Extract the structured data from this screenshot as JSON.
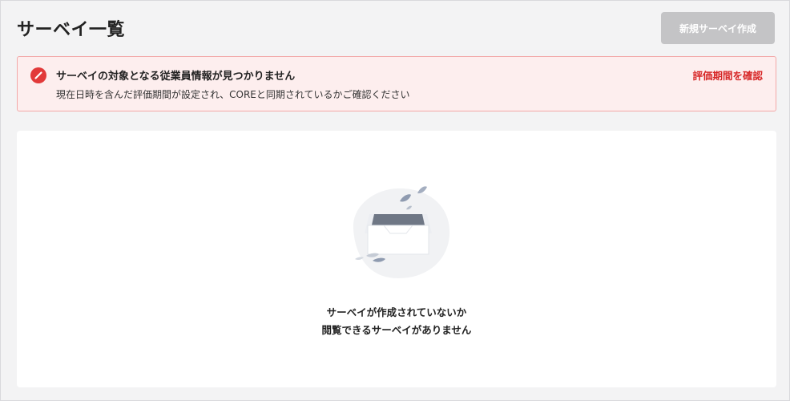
{
  "header": {
    "title": "サーベイ一覧",
    "create_button_label": "新規サーベイ作成"
  },
  "alert": {
    "title": "サーベイの対象となる従業員情報が見つかりません",
    "body": "現在日時を含んだ評価期間が設定され、COREと同期されているかご確認ください",
    "link_label": "評価期間を確認",
    "icon": "prohibited-icon",
    "accent_color": "#e23a3a"
  },
  "empty_state": {
    "icon": "empty-inbox-icon",
    "line1": "サーベイが作成されていないか",
    "line2": "閲覧できるサーベイがありません"
  },
  "colors": {
    "alert_background": "#fdeeee",
    "alert_border": "#f2a8a8",
    "link": "#d72626",
    "disabled_button": "#c4c4c6",
    "page_background": "#f3f3f4"
  }
}
